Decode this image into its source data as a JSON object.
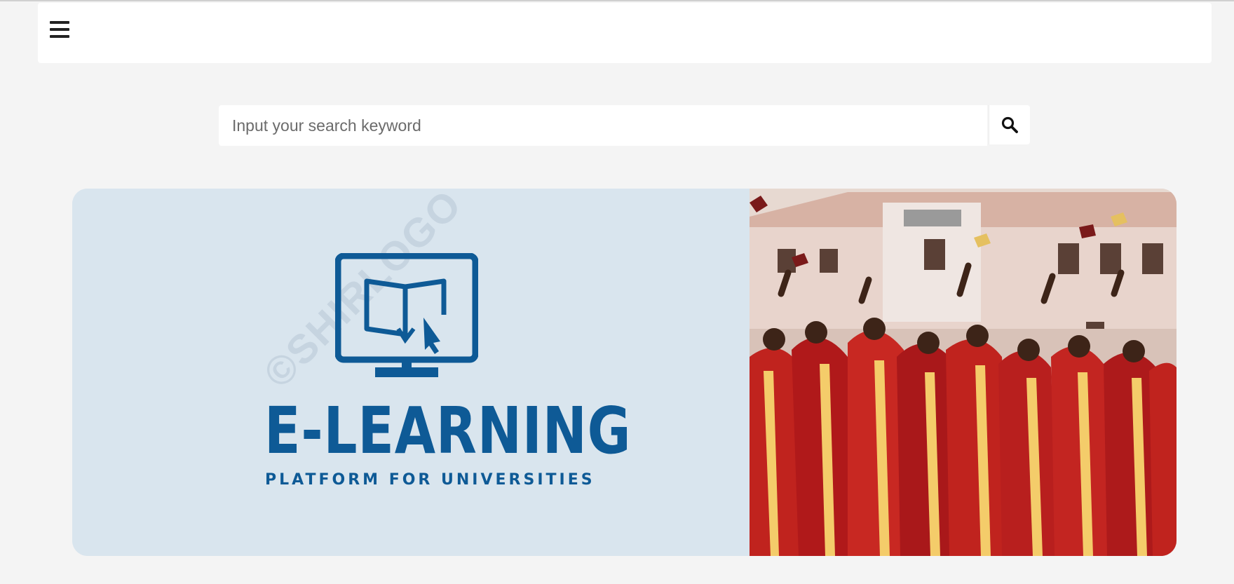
{
  "navbar": {
    "menu_icon": "hamburger-menu-icon"
  },
  "search": {
    "placeholder": "Input your search keyword",
    "value": "",
    "button_icon": "search-icon"
  },
  "banner": {
    "logo": {
      "title": "E-LEARNING",
      "subtitle": "PLATFORM FOR UNIVERSITIES",
      "watermark": "©SHIRLOGO",
      "color": "#0e5a96"
    },
    "background_color": "#d9e5ee"
  },
  "colors": {
    "page_background": "#f4f4f4",
    "gown_red": "#c0231e",
    "stole_gold": "#f4cc6a"
  }
}
